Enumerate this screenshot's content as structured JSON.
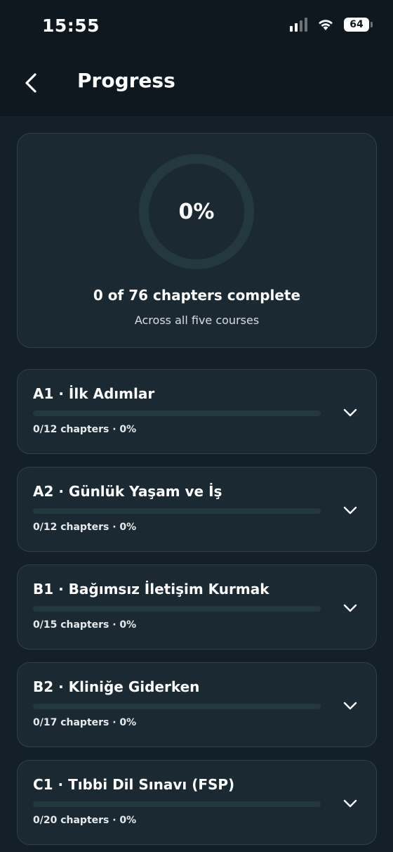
{
  "status_bar": {
    "time": "15:55",
    "battery": "64"
  },
  "header": {
    "title": "Progress"
  },
  "summary": {
    "percent_label": "0%",
    "progress": 0,
    "chapters_text": "0 of 76 chapters complete",
    "subtitle": "Across all five courses"
  },
  "courses": [
    {
      "title": "A1 · İlk Adımlar",
      "meta": "0/12 chapters · 0%",
      "progress": 0
    },
    {
      "title": "A2 · Günlük Yaşam ve İş",
      "meta": "0/12 chapters · 0%",
      "progress": 0
    },
    {
      "title": "B1 · Bağımsız İletişim Kurmak",
      "meta": "0/15 chapters · 0%",
      "progress": 0
    },
    {
      "title": "B2 · Kliniğe Giderken",
      "meta": "0/17 chapters · 0%",
      "progress": 0
    },
    {
      "title": "C1 · Tıbbi Dil Sınavı (FSP)",
      "meta": "0/20 chapters · 0%",
      "progress": 0
    }
  ],
  "colors": {
    "background": "#13202a",
    "card": "#1b2a32",
    "track": "#24393f",
    "accent": "#3ea88a"
  },
  "icons": {
    "back": "chevron-left-icon",
    "expand": "chevron-down-icon",
    "signal": "cellular-signal-icon",
    "wifi": "wifi-icon",
    "battery": "battery-icon"
  }
}
